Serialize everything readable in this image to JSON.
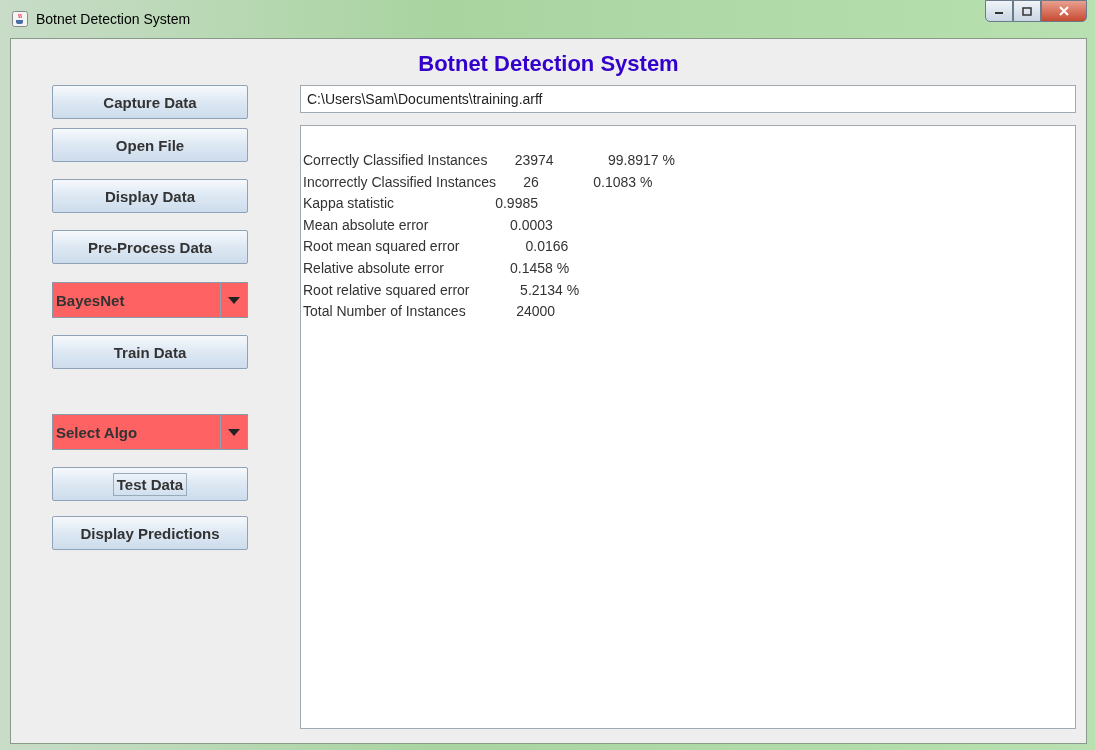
{
  "window": {
    "title": "Botnet Detection System"
  },
  "heading": "Botnet Detection System",
  "sidebar": [
    {
      "kind": "button",
      "label": "Capture Data",
      "focused": false
    },
    {
      "kind": "button",
      "label": "Open File",
      "focused": false
    },
    {
      "kind": "button",
      "label": "Display Data",
      "focused": false
    },
    {
      "kind": "button",
      "label": "Pre-Process Data",
      "focused": false
    },
    {
      "kind": "dropdown",
      "label": "BayesNet"
    },
    {
      "kind": "button",
      "label": "Train Data",
      "focused": false
    },
    {
      "kind": "dropdown",
      "label": "Select Algo"
    },
    {
      "kind": "button",
      "label": "Test Data",
      "focused": true
    },
    {
      "kind": "button",
      "label": "Display Predictions",
      "focused": false
    }
  ],
  "file_path": "C:\\Users\\Sam\\Documents\\training.arff",
  "output_lines": [
    "Correctly Classified Instances       23974              99.8917 %",
    "Incorrectly Classified Instances       26              0.1083 %",
    "Kappa statistic                          0.9985",
    "Mean absolute error                     0.0003",
    "Root mean squared error                 0.0166",
    "Relative absolute error                 0.1458 %",
    "Root relative squared error             5.2134 %",
    "Total Number of Instances             24000"
  ]
}
